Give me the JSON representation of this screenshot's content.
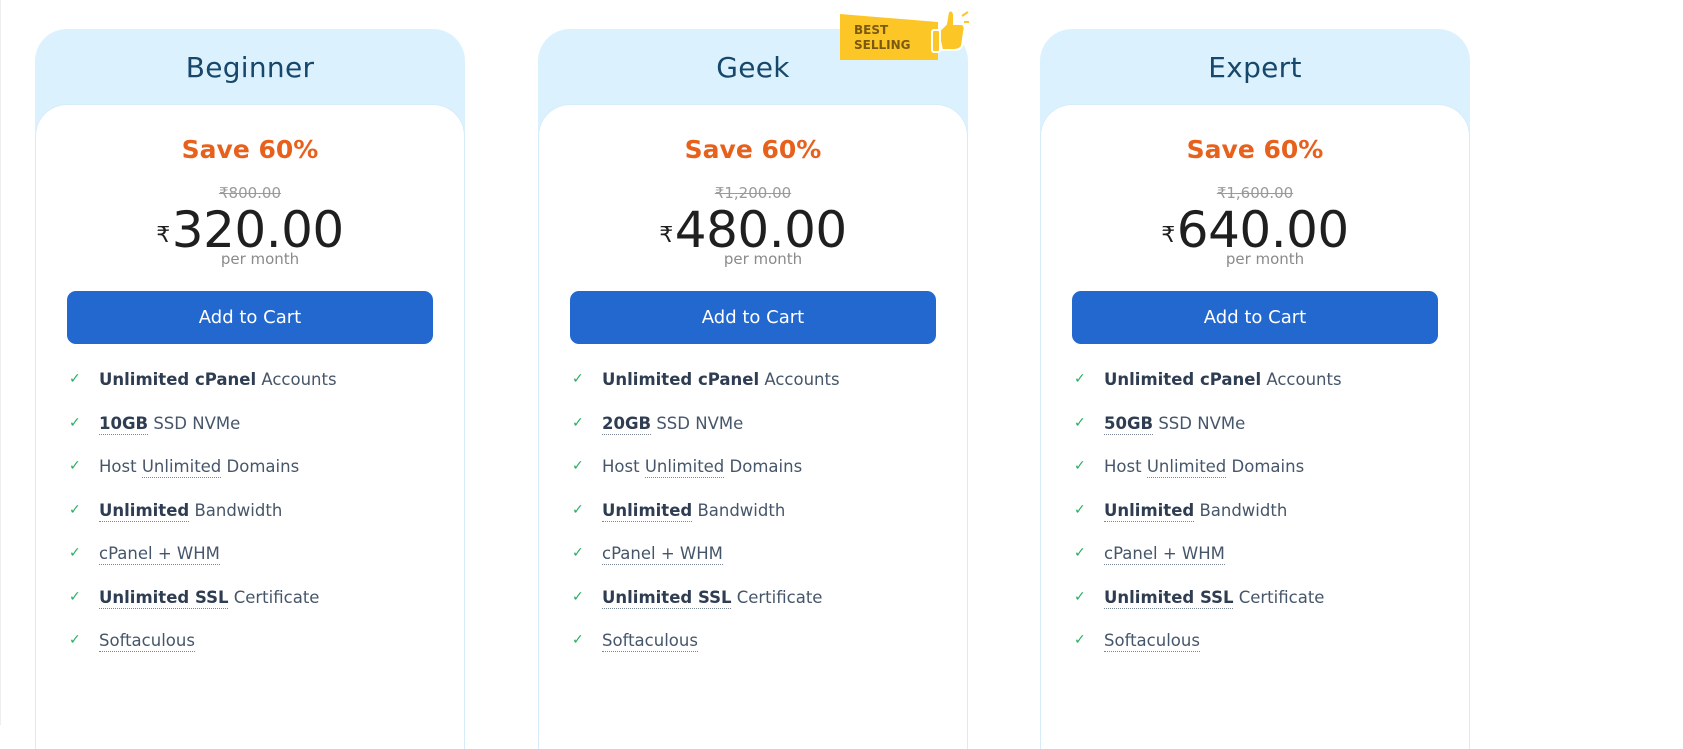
{
  "badge": {
    "line1": "BEST",
    "line2": "SELLING",
    "icon": "thumbs-up-icon",
    "color": "#fdc627"
  },
  "plans": [
    {
      "name": "Beginner",
      "save": "Save 60%",
      "old_price": "₹800.00",
      "currency": "₹",
      "price": "320.00",
      "period": "per month",
      "button": "Add to Cart",
      "features": [
        {
          "bold": "Unlimited cPanel",
          "text": " Accounts",
          "underline": false
        },
        {
          "bold": "10GB",
          "text": " SSD NVMe",
          "underline": true
        },
        {
          "pre": "Host ",
          "ul": "Unlimited",
          "text": " Domains"
        },
        {
          "bold": "Unlimited",
          "text": " Bandwidth",
          "underline": true
        },
        {
          "ul": "cPanel + WHM"
        },
        {
          "bold": "Unlimited SSL",
          "text": " Certificate",
          "underline": true
        },
        {
          "ul": "Softaculous"
        }
      ]
    },
    {
      "name": "Geek",
      "save": "Save 60%",
      "old_price": "₹1,200.00",
      "currency": "₹",
      "price": "480.00",
      "period": "per month",
      "button": "Add to Cart",
      "features": [
        {
          "bold": "Unlimited cPanel",
          "text": " Accounts",
          "underline": false
        },
        {
          "bold": "20GB",
          "text": " SSD NVMe",
          "underline": true
        },
        {
          "pre": "Host ",
          "ul": "Unlimited",
          "text": " Domains"
        },
        {
          "bold": "Unlimited",
          "text": " Bandwidth",
          "underline": true
        },
        {
          "ul": "cPanel + WHM"
        },
        {
          "bold": "Unlimited SSL",
          "text": " Certificate",
          "underline": true
        },
        {
          "ul": "Softaculous"
        }
      ]
    },
    {
      "name": "Expert",
      "save": "Save 60%",
      "old_price": "₹1,600.00",
      "currency": "₹",
      "price": "640.00",
      "period": "per month",
      "button": "Add to Cart",
      "features": [
        {
          "bold": "Unlimited cPanel",
          "text": " Accounts",
          "underline": false
        },
        {
          "bold": "50GB",
          "text": " SSD NVMe",
          "underline": true
        },
        {
          "pre": "Host ",
          "ul": "Unlimited",
          "text": " Domains"
        },
        {
          "bold": "Unlimited",
          "text": " Bandwidth",
          "underline": true
        },
        {
          "ul": "cPanel + WHM"
        },
        {
          "bold": "Unlimited SSL",
          "text": " Certificate",
          "underline": true
        },
        {
          "ul": "Softaculous"
        }
      ]
    }
  ],
  "colors": {
    "accent_blue": "#2368cf",
    "save_orange": "#e7611c",
    "check_green": "#27ae60",
    "header_bg": "#dbf2fe",
    "title_navy": "#17476b"
  }
}
